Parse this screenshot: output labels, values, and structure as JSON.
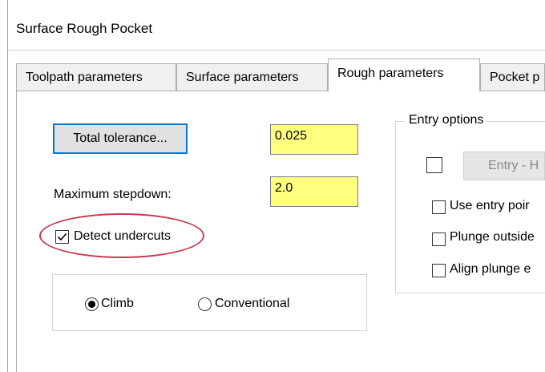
{
  "window": {
    "title": "Surface Rough Pocket"
  },
  "tabs": [
    {
      "label": "Toolpath parameters"
    },
    {
      "label": "Surface parameters"
    },
    {
      "label": "Rough parameters"
    },
    {
      "label": "Pocket p"
    }
  ],
  "rough": {
    "total_tolerance_button": "Total tolerance...",
    "total_tolerance_value": "0.025",
    "max_stepdown_label": "Maximum stepdown:",
    "max_stepdown_value": "2.0",
    "detect_undercuts_label": "Detect undercuts",
    "detect_undercuts_checked": true,
    "cut_direction": {
      "climb_label": "Climb",
      "conventional_label": "Conventional",
      "selected": "Climb"
    }
  },
  "entry_options": {
    "legend": "Entry options",
    "entry_button": "Entry - H",
    "use_entry_point_label": "Use entry poir",
    "plunge_outside_label": "Plunge outside",
    "align_plunge_label": "Align plunge e"
  },
  "colors": {
    "input_highlight": "#ffff80",
    "annotation": "#c8384d",
    "focus_border": "#0078d7"
  }
}
